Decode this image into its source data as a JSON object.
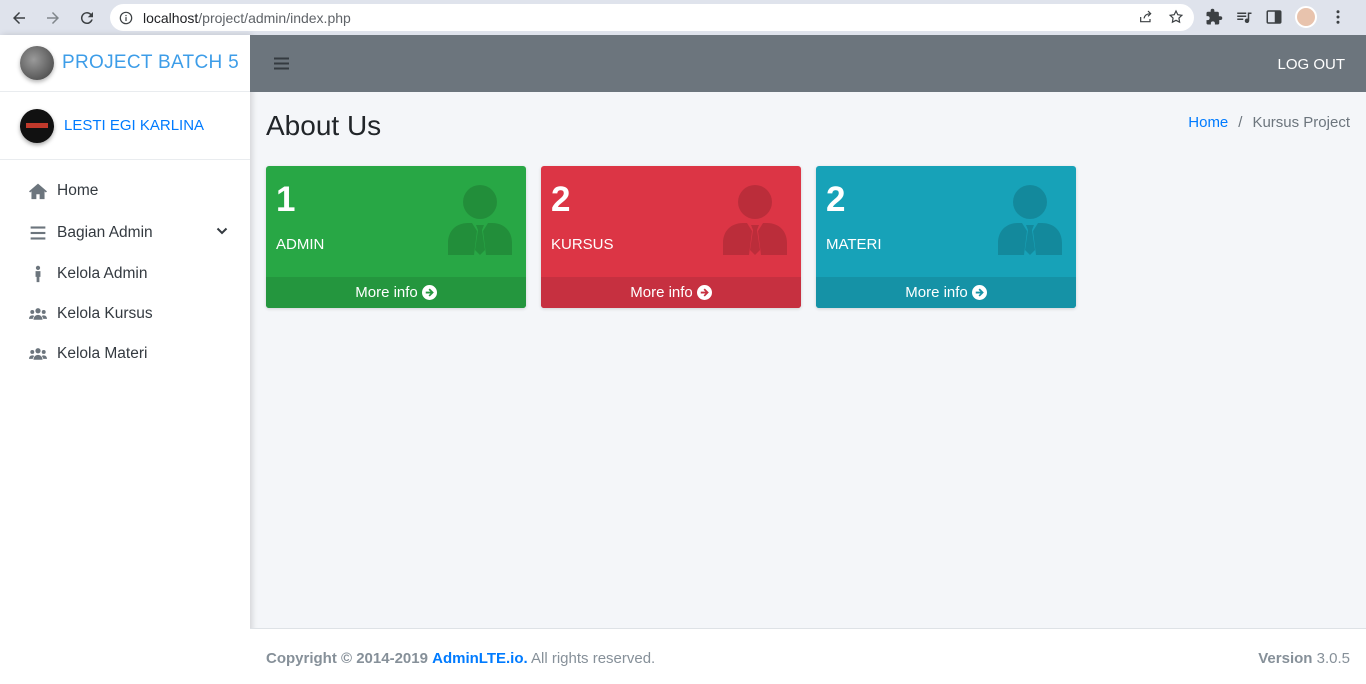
{
  "browser": {
    "url_host": "localhost",
    "url_path": "/project/admin/index.php"
  },
  "sidebar": {
    "brand": "PROJECT BATCH 5",
    "user_name": "LESTI EGI KARLINA",
    "items": [
      {
        "label": "Home",
        "icon": "home-icon"
      },
      {
        "label": "Bagian Admin",
        "icon": "bars-icon"
      },
      {
        "label": "Kelola Admin",
        "icon": "user-icon"
      },
      {
        "label": "Kelola Kursus",
        "icon": "users-icon"
      },
      {
        "label": "Kelola Materi",
        "icon": "users-icon"
      }
    ]
  },
  "navbar": {
    "logout_label": "LOG OUT"
  },
  "content": {
    "title": "About Us",
    "breadcrumb": {
      "home": "Home",
      "separator": "/",
      "current": "Kursus Project"
    },
    "boxes": [
      {
        "count": "1",
        "label": "ADMIN",
        "footer": "More info",
        "color": "#28a745"
      },
      {
        "count": "2",
        "label": "KURSUS",
        "footer": "More info",
        "color": "#dc3545"
      },
      {
        "count": "2",
        "label": "MATERI",
        "footer": "More info",
        "color": "#17a2b8"
      }
    ]
  },
  "footer": {
    "copyright": "Copyright © 2014-2019",
    "brand_link": "AdminLTE.io.",
    "rights": "All rights reserved.",
    "version_label": "Version",
    "version": "3.0.5"
  }
}
